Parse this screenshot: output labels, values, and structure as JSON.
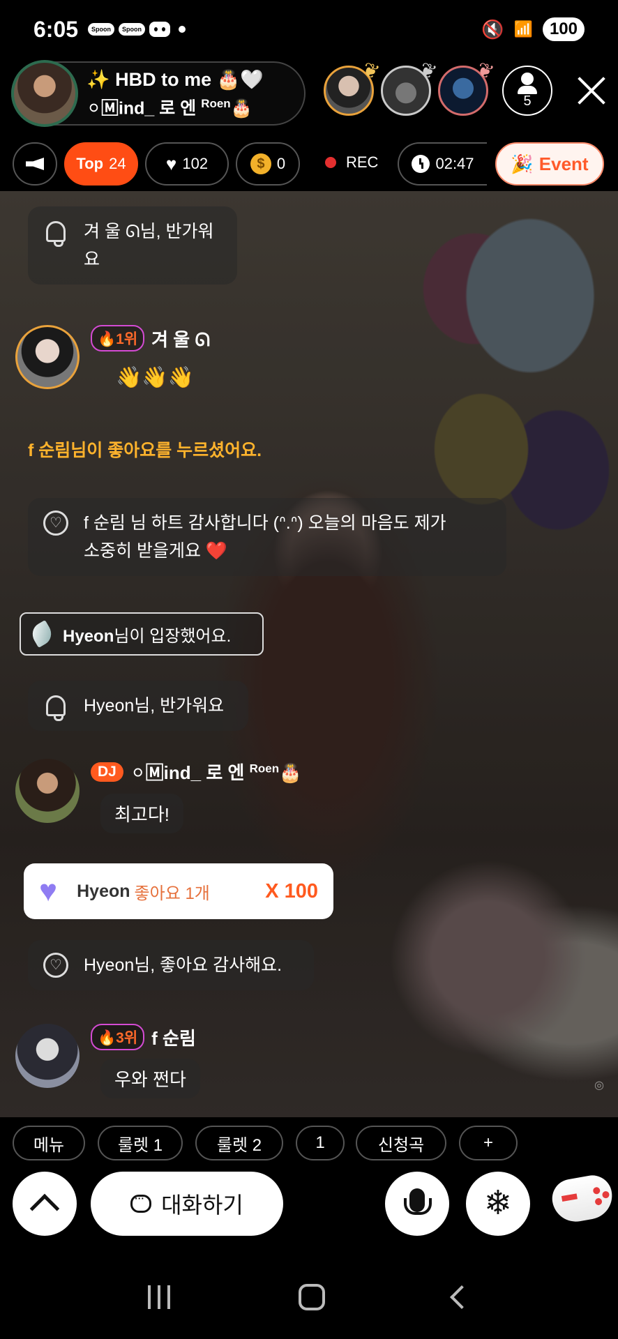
{
  "status_bar": {
    "time": "6:05",
    "notif_1": "Spoon",
    "notif_2": "Spoon",
    "battery": "100"
  },
  "header": {
    "host_title": "✨ HBD to me 🎂🤍",
    "host_name": "⚪🄼ind_ 로 엔",
    "host_name_sup": "Roen",
    "host_name_suffix": "🎂",
    "listener_count": "5"
  },
  "pills": {
    "top_label": "Top",
    "top_value": "24",
    "likes": "102",
    "coins": "0",
    "rec": "REC",
    "timer": "02:47",
    "event": "Event"
  },
  "chat": {
    "msg1_text": "겨 울 ᘏ님, 반가워요",
    "msg2_rank": "🔥1위",
    "msg2_name": "겨 울 ᘏ",
    "msg2_text": "👋👋👋",
    "like_notice": "f 순림님이 좋아요를 누르셨어요.",
    "msg3_line1": "f 순림 님 하트 감사합니다 (ᐢ.ᐢ) 오늘의 마음도 제가",
    "msg3_line2": "소중히 받을게요 ❤️",
    "enter_user": "Hyeon",
    "enter_text": "님이 입장했어요.",
    "msg4_text": "Hyeon님, 반가워요",
    "msg5_badge": "DJ",
    "msg5_name": "⚪🄼ind_ 로 엔",
    "msg5_sup": "Roen",
    "msg5_suffix": "🎂",
    "msg5_text": "최고다!",
    "gift_user": "Hyeon",
    "gift_text": "좋아요 1개",
    "gift_mult": "X 100",
    "msg6_text": "Hyeon님, 좋아요 감사해요.",
    "msg7_rank": "🔥3위",
    "msg7_name": "f 순림",
    "msg7_text": "우와 쩐다"
  },
  "quick_buttons": [
    "메뉴",
    "룰렛 1",
    "룰렛 2",
    "1",
    "신청곡",
    "+"
  ],
  "controls": {
    "chat_label": "대화하기"
  },
  "colors": {
    "accent": "#ff4d14",
    "like_notice": "#ffb32c",
    "gift_mult": "#ff5a1f"
  },
  "icons": [
    "bell-icon",
    "heart-icon",
    "coin-icon",
    "clock-icon",
    "megaphone-icon",
    "mic-icon",
    "snowflake-icon",
    "gamepad-icon"
  ]
}
